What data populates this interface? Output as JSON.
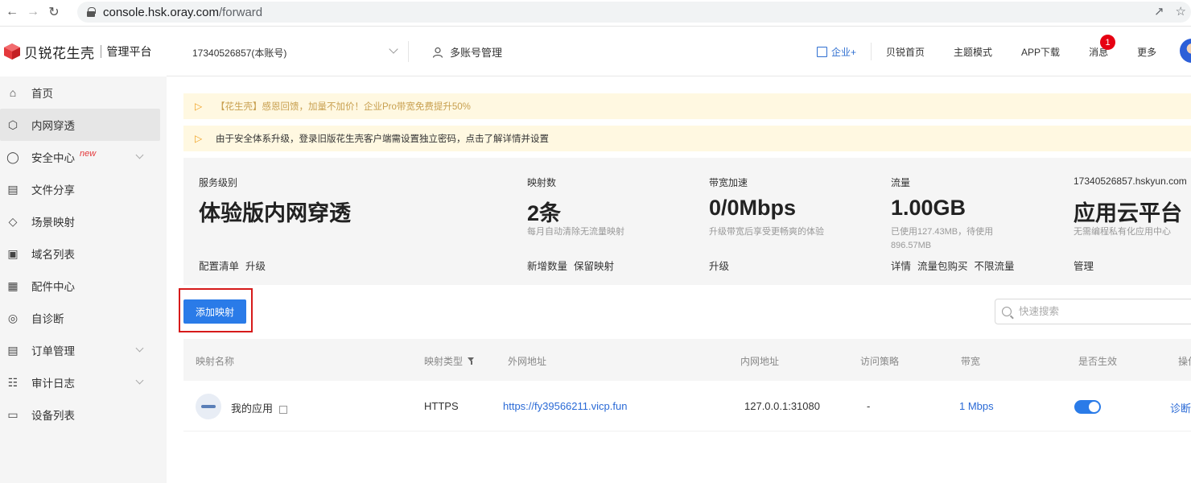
{
  "browser": {
    "url_host": "console.hsk.oray.com",
    "url_path": "/forward"
  },
  "brand": {
    "name": "贝锐花生壳",
    "subtitle": "管理平台",
    "color": "#e4393c"
  },
  "sidebar": {
    "items": [
      {
        "label": "首页",
        "icon": "home-icon"
      },
      {
        "label": "内网穿透",
        "icon": "cube-icon",
        "active": true
      },
      {
        "label": "安全中心",
        "icon": "shield-icon",
        "badge": "new",
        "expandable": true
      },
      {
        "label": "文件分享",
        "icon": "file-share-icon"
      },
      {
        "label": "场景映射",
        "icon": "layers-icon"
      },
      {
        "label": "域名列表",
        "icon": "domain-icon"
      },
      {
        "label": "配件中心",
        "icon": "grid-icon"
      },
      {
        "label": "自诊断",
        "icon": "diagnose-icon"
      },
      {
        "label": "订单管理",
        "icon": "order-icon",
        "expandable": true
      },
      {
        "label": "审计日志",
        "icon": "log-icon",
        "expandable": true
      },
      {
        "label": "设备列表",
        "icon": "monitor-icon"
      }
    ]
  },
  "header": {
    "account": "17340526857(本账号)",
    "multi_account": "多账号管理",
    "enterprise": "企业+",
    "nav": [
      "贝锐首页",
      "主题模式",
      "APP下载",
      "消息",
      "更多"
    ],
    "message_badge": "1"
  },
  "notices": [
    "【花生壳】感恩回馈，加量不加价！企业Pro带宽免费提升50%",
    "由于安全体系升级，登录旧版花生壳客户端需设置独立密码，点击了解详情并设置"
  ],
  "stats": {
    "service": {
      "label": "服务级别",
      "value": "体验版内网穿透",
      "actions": [
        "配置清单",
        "升级"
      ]
    },
    "mappings": {
      "label": "映射数",
      "value": "2条",
      "note": "每月自动清除无流量映射",
      "actions": [
        "新增数量",
        "保留映射"
      ]
    },
    "bandwidth": {
      "label": "带宽加速",
      "value": "0/0Mbps",
      "note": "升级带宽后享受更畅爽的体验",
      "actions": [
        "升级"
      ]
    },
    "traffic": {
      "label": "流量",
      "value": "1.00GB",
      "note_line1": "已使用127.43MB，待使用",
      "note_line2": "896.57MB",
      "actions": [
        "详情",
        "流量包购买",
        "不限流量"
      ]
    },
    "cloud": {
      "label": "17340526857.hskyun.com",
      "value": "应用云平台",
      "note": "无需编程私有化应用中心",
      "actions": [
        "管理"
      ]
    }
  },
  "toolbar": {
    "add_label": "添加映射",
    "search_placeholder": "快速搜索"
  },
  "table": {
    "headers": [
      "映射名称",
      "映射类型",
      "外网地址",
      "内网地址",
      "访问策略",
      "带宽",
      "是否生效",
      "操作"
    ],
    "rows": [
      {
        "name": "我的应用",
        "type": "HTTPS",
        "external": "https://fy39566211.vicp.fun",
        "internal": "127.0.0.1:31080",
        "policy": "-",
        "bandwidth": "1 Mbps",
        "enabled": true,
        "action": "诊断"
      }
    ]
  }
}
